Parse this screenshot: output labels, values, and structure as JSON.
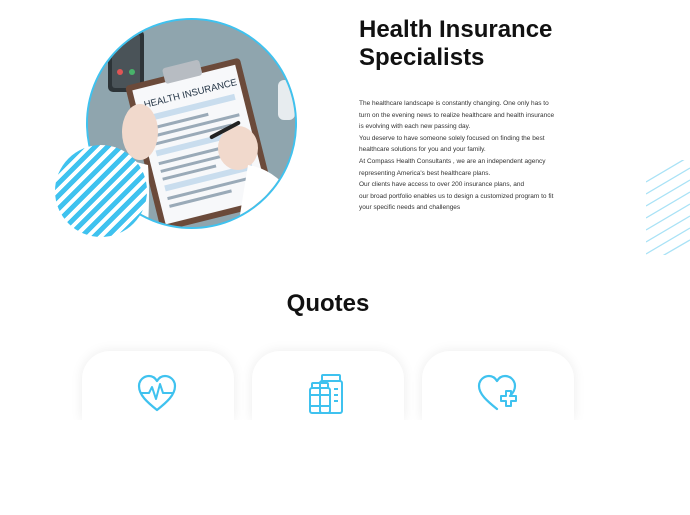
{
  "hero": {
    "title_line1": "Health Insurance",
    "title_line2": "Specialists",
    "photo_text": "HEALTH INSURANCE",
    "accent_color": "#3fc2ef"
  },
  "description": {
    "lines": [
      "The healthcare landscape is constantly changing. One only has to",
      "turn on the evening news to realize healthcare and health insurance",
      "is evolving with each new passing day.",
      "You deserve to have someone solely focused on finding the best",
      "healthcare solutions for you and your family.",
      "At Compass Health Consultants , we are an independent agency",
      "representing America's best healthcare plans.",
      "Our clients have access to over 200 insurance plans, and",
      "our broad portfolio enables us to design a customized program to fit",
      "your specific needs and challenges"
    ]
  },
  "quotes": {
    "heading": "Quotes",
    "cards": [
      {
        "icon": "heart-pulse-icon"
      },
      {
        "icon": "medicine-bottles-icon"
      },
      {
        "icon": "heart-plus-icon"
      }
    ]
  }
}
